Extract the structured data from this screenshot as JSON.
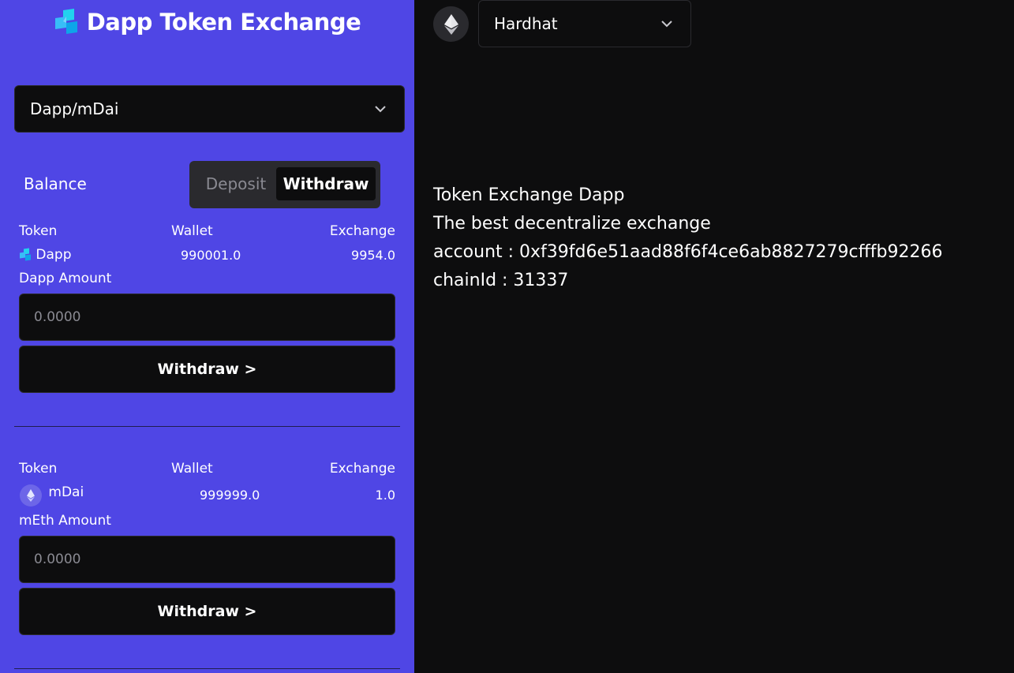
{
  "app": {
    "title": "Dapp Token Exchange"
  },
  "sidebar": {
    "market_selector": {
      "selected": "Dapp/mDai"
    },
    "balance": {
      "label": "Balance",
      "tabs": [
        {
          "label": "Deposit",
          "active": false
        },
        {
          "label": "Withdraw",
          "active": true
        }
      ],
      "columns": {
        "token": "Token",
        "wallet": "Wallet",
        "exchange": "Exchange"
      },
      "token1": {
        "name": "Dapp",
        "icon": "dapp-logo-icon",
        "wallet": "990001.0",
        "exchange": "9954.0",
        "amount_label": "Dapp Amount",
        "amount_placeholder": "0.0000",
        "button_label": "Withdraw >"
      },
      "token2": {
        "name": "mDai",
        "icon": "ethereum-icon",
        "wallet": "999999.0",
        "exchange": "1.0",
        "amount_label": "mEth Amount",
        "amount_placeholder": "0.0000",
        "button_label": "Withdraw >"
      }
    }
  },
  "header": {
    "network": {
      "icon": "ethereum-icon",
      "selected": "Hardhat"
    }
  },
  "main": {
    "lines": [
      "Token Exchange Dapp",
      "The best decentralize exchange",
      "account : 0xf39fd6e51aad88f6f4ce6ab8827279cfffb92266",
      "chainId : 31337"
    ]
  },
  "colors": {
    "sidebar_bg": "#4f46e5",
    "main_bg": "#0d0d0e",
    "control_bg": "#0d0d0e",
    "tab_group_bg": "#2a2a2e"
  }
}
